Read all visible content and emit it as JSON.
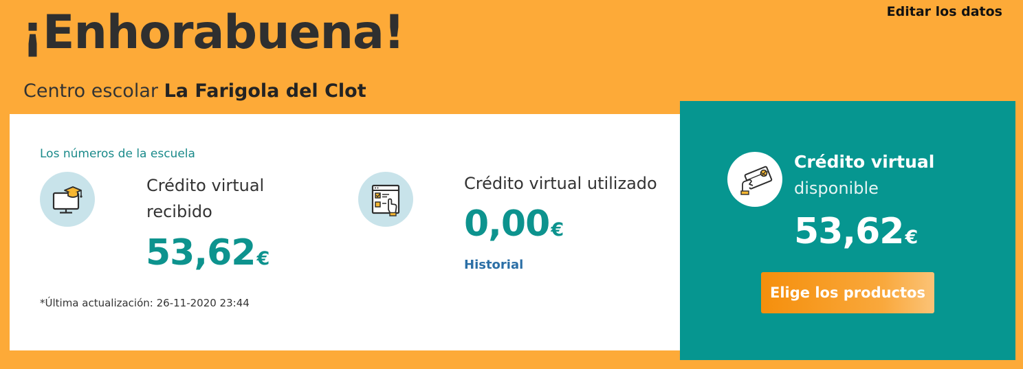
{
  "header": {
    "headline": "¡Enhorabuena!",
    "edit_link": "Editar los datos",
    "school_prefix": "Centro escolar",
    "school_name": "La Farigola del Clot"
  },
  "stats": {
    "title": "Los números de la escuela",
    "received": {
      "icon": "graduation-computer-icon",
      "label": "Crédito virtual recibido",
      "amount": "53,62",
      "currency": "€"
    },
    "used": {
      "icon": "checklist-touch-icon",
      "label": "Crédito virtual utilizado",
      "amount": "0,00",
      "currency": "€",
      "history_link": "Historial"
    },
    "update_note": "*Última actualización: 26-11-2020 23:44"
  },
  "available_credit": {
    "icon": "gift-card-hand-icon",
    "title": "Crédito virtual",
    "subtitle": "disponible",
    "amount": "53,62",
    "currency": "€",
    "button_label": "Elige los productos"
  },
  "colors": {
    "page_background": "#fdaa38",
    "accent_teal": "#069690",
    "amount_teal": "#0d938e",
    "link_blue": "#2b6fa6",
    "button_orange": "#f58f0c",
    "icon_circle": "#c8e3ea"
  }
}
